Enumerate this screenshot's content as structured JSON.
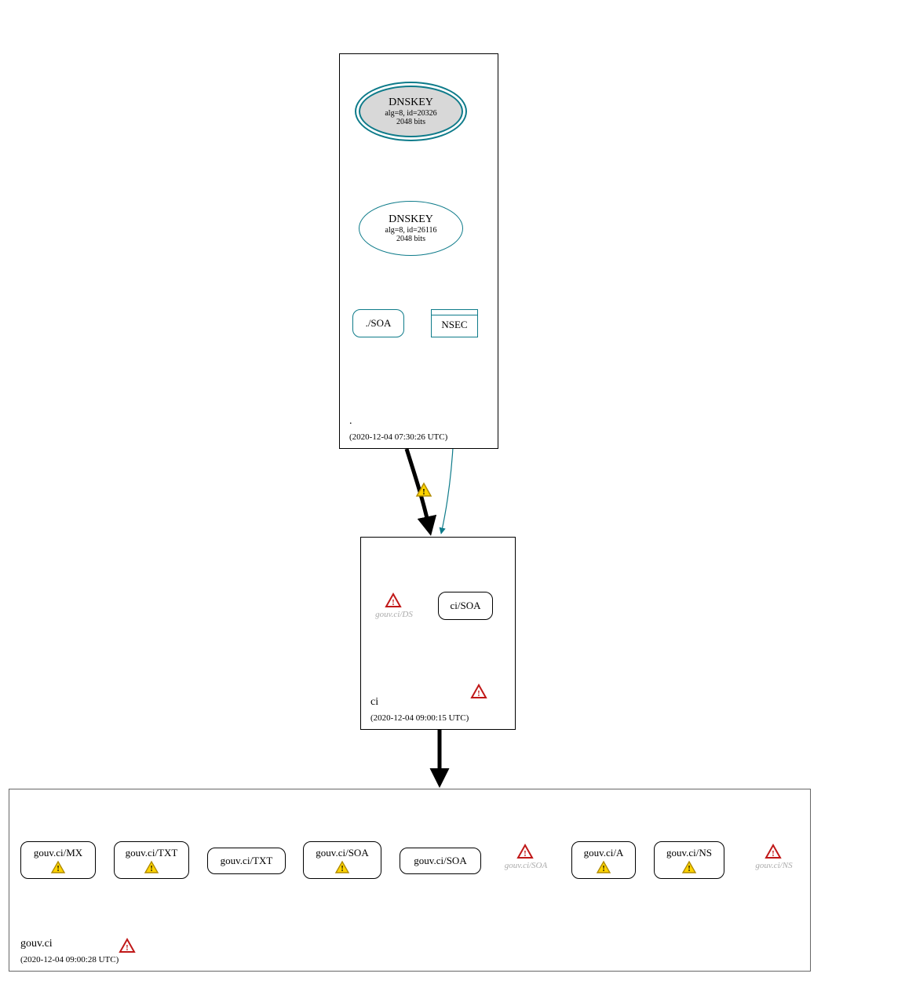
{
  "zones": {
    "root": {
      "label": ".",
      "timestamp": "(2020-12-04 07:30:26 UTC)",
      "dnskey_ksk": {
        "title": "DNSKEY",
        "detail": "alg=8, id=20326",
        "bits": "2048 bits"
      },
      "dnskey_zsk": {
        "title": "DNSKEY",
        "detail": "alg=8, id=26116",
        "bits": "2048 bits"
      },
      "soa": "./SOA",
      "nsec": "NSEC"
    },
    "ci": {
      "label": "ci",
      "timestamp": "(2020-12-04 09:00:15 UTC)",
      "ds_ghost": "gouv.ci/DS",
      "soa": "ci/SOA"
    },
    "gouv": {
      "label": "gouv.ci",
      "timestamp": "(2020-12-04 09:00:28 UTC)",
      "records": {
        "mx": "gouv.ci/MX",
        "txt1": "gouv.ci/TXT",
        "txt2": "gouv.ci/TXT",
        "soa1": "gouv.ci/SOA",
        "soa2": "gouv.ci/SOA",
        "soa_ghost": "gouv.ci/SOA",
        "a": "gouv.ci/A",
        "ns": "gouv.ci/NS",
        "ns_ghost": "gouv.ci/NS"
      }
    }
  }
}
